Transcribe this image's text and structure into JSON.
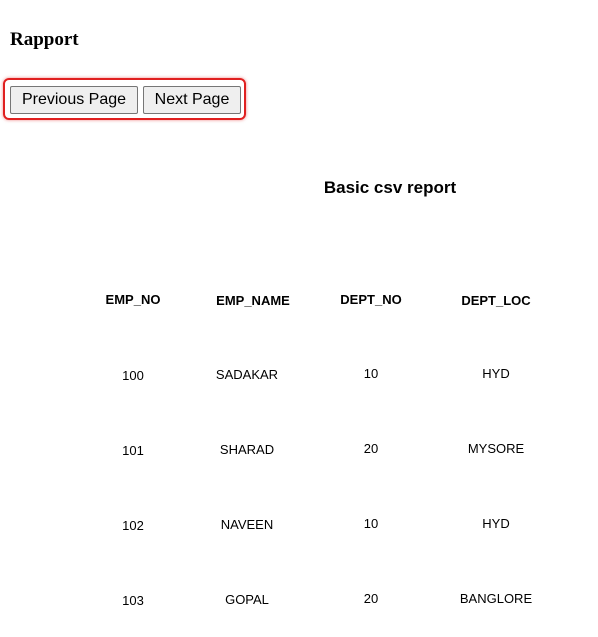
{
  "page": {
    "title": "Rapport"
  },
  "pager": {
    "previous_label": "Previous Page",
    "next_label": "Next Page"
  },
  "report": {
    "title": "Basic csv report",
    "columns": [
      "EMP_NO",
      "EMP_NAME",
      "DEPT_NO",
      "DEPT_LOC"
    ],
    "rows": [
      [
        "100",
        "SADAKAR",
        "10",
        "HYD"
      ],
      [
        "101",
        "SHARAD",
        "20",
        "MYSORE"
      ],
      [
        "102",
        "NAVEEN",
        "10",
        "HYD"
      ],
      [
        "103",
        "GOPAL",
        "20",
        "BANGLORE"
      ]
    ]
  },
  "colors": {
    "highlight": "#e02020",
    "button_bg": "#efefef"
  }
}
